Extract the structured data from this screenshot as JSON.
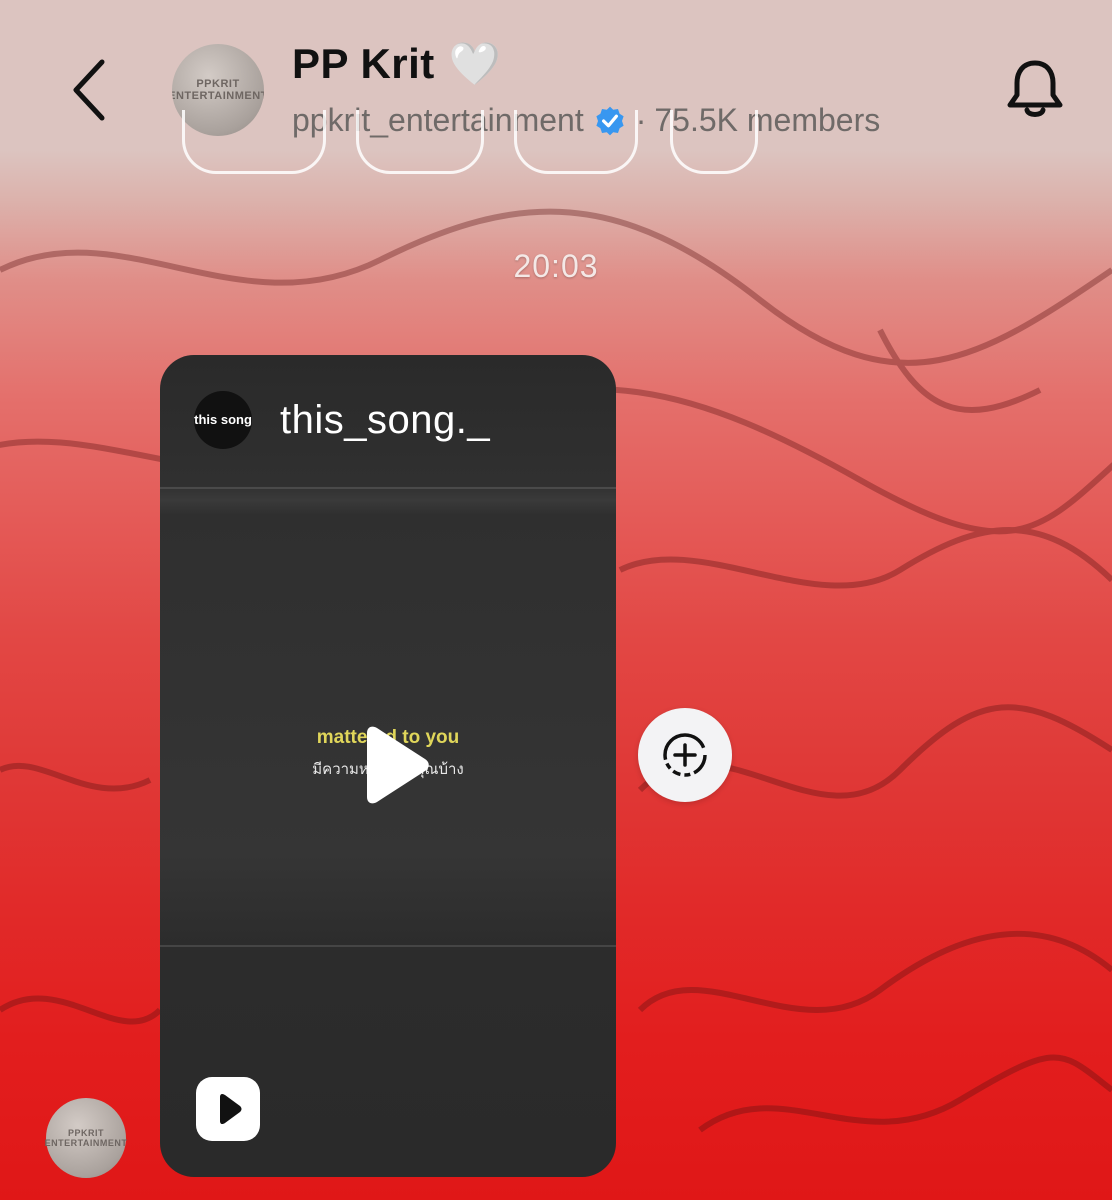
{
  "header": {
    "title": "PP Krit",
    "title_emoji": "🤍",
    "username": "ppkrit_entertainment",
    "separator": "·",
    "members": "75.5K members",
    "avatar_text": "PPKRIT ENTERTAINMENT",
    "icons": {
      "back": "chevron-left-icon",
      "verified": "verified-badge-icon",
      "notifications": "bell-icon"
    }
  },
  "chat": {
    "timestamp": "20:03",
    "shared_reel": {
      "username": "this_song._",
      "account_avatar_text": "this song",
      "lyric_line_1": "mattered to you",
      "lyric_line_2": "มีความหมายกับคุณบ้าง",
      "icons": {
        "play": "play-icon",
        "reel": "reels-icon"
      }
    },
    "share_button_icon": "add-to-story-icon",
    "sender_avatar_text": "PPKRIT ENTERTAINMENT"
  },
  "colors": {
    "header_bg": "#dcc4c0",
    "verified_blue": "#3897f0",
    "background_red": "#e01717"
  }
}
